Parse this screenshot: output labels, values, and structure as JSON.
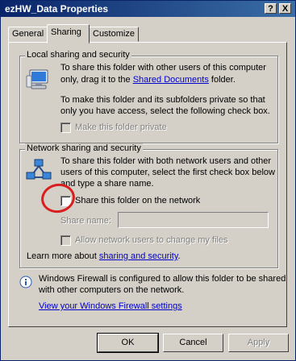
{
  "window": {
    "title": "ezHW_Data Properties",
    "help_glyph": "?",
    "close_glyph": "X"
  },
  "tabs": [
    {
      "label": "General"
    },
    {
      "label": "Sharing"
    },
    {
      "label": "Customize"
    }
  ],
  "local": {
    "legend": "Local sharing and security",
    "line1": "To share this folder with other users of this computer",
    "line2_pre": "only, drag it to the ",
    "line2_link": "Shared Documents",
    "line2_post": " folder.",
    "line3": "To make this folder and its subfolders private so that",
    "line4": "only you have access, select the following check box.",
    "private_label": "Make this folder private",
    "private_checked": false,
    "private_enabled": false
  },
  "network": {
    "legend": "Network sharing and security",
    "line1": "To share this folder with both network users and other",
    "line2": "users of this computer, select the first check box below",
    "line3": "and type a share name.",
    "share_label": "Share this folder on the network",
    "share_checked": false,
    "share_name_label": "Share name:",
    "share_name_value": "",
    "allow_label": "Allow network users to change my files",
    "allow_checked": false,
    "learn_pre": "Learn more about ",
    "learn_link": "sharing and security",
    "learn_post": "."
  },
  "firewall": {
    "line1": "Windows Firewall is configured to allow this folder to be shared",
    "line2": "with other computers on the network.",
    "link": "View your Windows Firewall settings"
  },
  "buttons": {
    "ok": "OK",
    "cancel": "Cancel",
    "apply": "Apply"
  },
  "colors": {
    "titlebar_start": "#0a246a",
    "titlebar_end": "#3a6ea5",
    "dialog_face": "#d4d0c8",
    "link": "#0000cc",
    "highlight_circle": "#d81e1e"
  }
}
